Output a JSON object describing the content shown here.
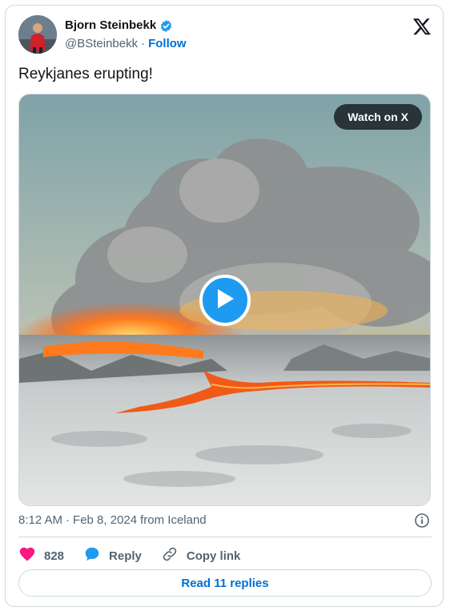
{
  "author": {
    "name": "Bjorn Steinbekk",
    "handle": "@BSteinbekk",
    "follow_label": "Follow"
  },
  "separator": "·",
  "tweet": {
    "text": "Reykjanes erupting!"
  },
  "media": {
    "watch_label": "Watch on X",
    "play_icon": "play-icon"
  },
  "meta": {
    "time": "8:12 AM",
    "date": "Feb 8, 2024",
    "location": "from Iceland"
  },
  "actions": {
    "like_count": "828",
    "reply_label": "Reply",
    "copy_label": "Copy link"
  },
  "read_replies_label": "Read 11 replies",
  "colors": {
    "accent": "#1d9bf0",
    "link": "#006fd6",
    "like": "#f91880",
    "secondary_text": "#536471",
    "border": "#cfd9de"
  }
}
